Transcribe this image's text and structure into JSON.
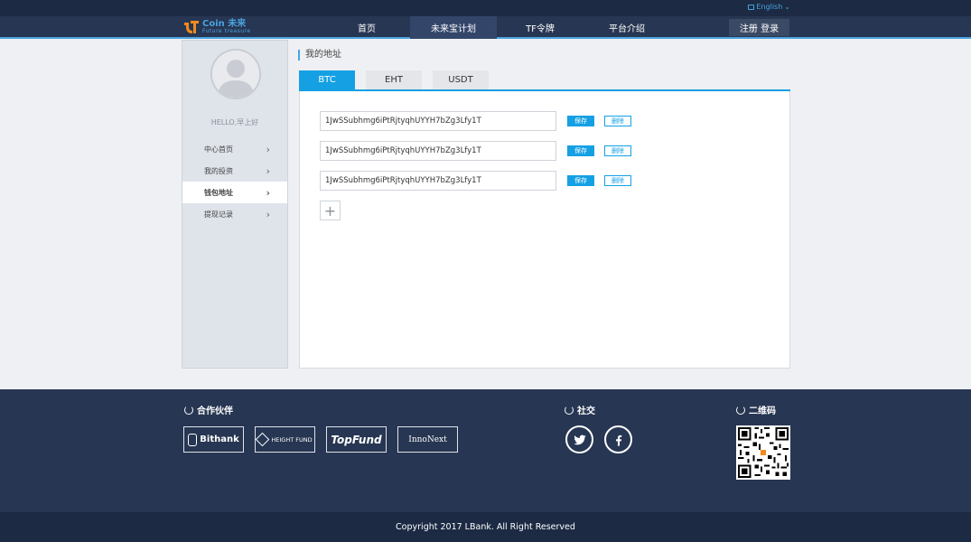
{
  "topbar": {
    "language": "English"
  },
  "logo": {
    "name": "Coin 未来",
    "tagline": "Future treasure"
  },
  "nav": {
    "items": [
      {
        "label": "首页"
      },
      {
        "label": "未来宝计划"
      },
      {
        "label": "TF令牌"
      },
      {
        "label": "平台介绍"
      }
    ],
    "login_label": "注册 登录"
  },
  "sidebar": {
    "greeting": "HELLO,早上好",
    "items": [
      {
        "label": "中心首页"
      },
      {
        "label": "我的投资"
      },
      {
        "label": "钱包地址"
      },
      {
        "label": "提现记录"
      }
    ]
  },
  "main": {
    "title": "我的地址",
    "tabs": [
      {
        "label": "BTC"
      },
      {
        "label": "EHT"
      },
      {
        "label": "USDT"
      }
    ],
    "addresses": [
      {
        "value": "1JwSSubhmg6iPtRjtyqhUYYH7bZg3Lfy1T",
        "save_label": "保存",
        "delete_label": "删除"
      },
      {
        "value": "1JwSSubhmg6iPtRjtyqhUYYH7bZg3Lfy1T",
        "save_label": "保存",
        "delete_label": "删除"
      },
      {
        "value": "1JwSSubhmg6iPtRjtyqhUYYH7bZg3Lfy1T",
        "save_label": "保存",
        "delete_label": "删除"
      }
    ],
    "add_icon": "plus-icon"
  },
  "footer": {
    "partners_title": "合作伙伴",
    "partners": [
      {
        "label": "Bithank"
      },
      {
        "label": "HEIGHT FUND"
      },
      {
        "label": "TopFund"
      },
      {
        "label": "InnoNext"
      }
    ],
    "social_title": "社交",
    "socials": [
      {
        "icon": "twitter-icon"
      },
      {
        "icon": "facebook-icon"
      }
    ],
    "qr_title": "二维码",
    "copyright": "Copyright 2017 LBank. All Right Reserved"
  },
  "colors": {
    "accent": "#15a0e4",
    "nav_bg": "#273652",
    "topbar_bg": "#1c2a44",
    "page_bg": "#eef0f3"
  }
}
